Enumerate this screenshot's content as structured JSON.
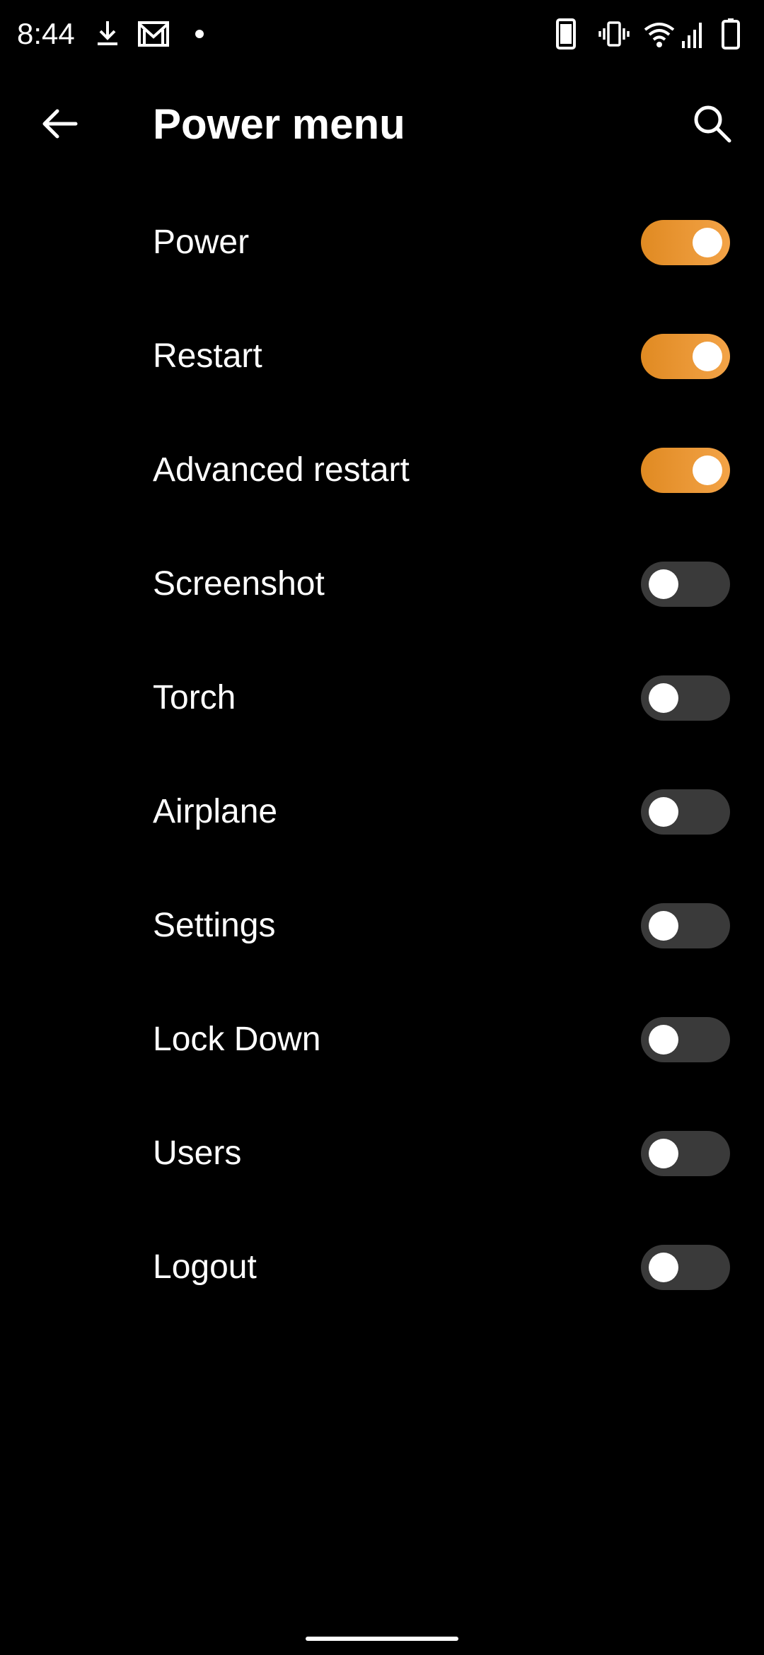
{
  "status_bar": {
    "time": "8:44",
    "icons": [
      "download-icon",
      "gmail-icon",
      "notification-dot-icon",
      "phone-icon",
      "vibrate-icon",
      "wifi-icon",
      "signal-icon",
      "battery-icon"
    ]
  },
  "app_bar": {
    "title": "Power menu",
    "back_icon": "arrow-left-icon",
    "search_icon": "search-icon"
  },
  "items": [
    {
      "label": "Power",
      "enabled": true
    },
    {
      "label": "Restart",
      "enabled": true
    },
    {
      "label": "Advanced restart",
      "enabled": true
    },
    {
      "label": "Screenshot",
      "enabled": false
    },
    {
      "label": "Torch",
      "enabled": false
    },
    {
      "label": "Airplane",
      "enabled": false
    },
    {
      "label": "Settings",
      "enabled": false
    },
    {
      "label": "Lock Down",
      "enabled": false
    },
    {
      "label": "Users",
      "enabled": false
    },
    {
      "label": "Logout",
      "enabled": false
    }
  ],
  "colors": {
    "background": "#000000",
    "text": "#ffffff",
    "accent": "#e8922e",
    "switch_off_track": "#3a3a3a",
    "switch_thumb": "#ffffff"
  }
}
